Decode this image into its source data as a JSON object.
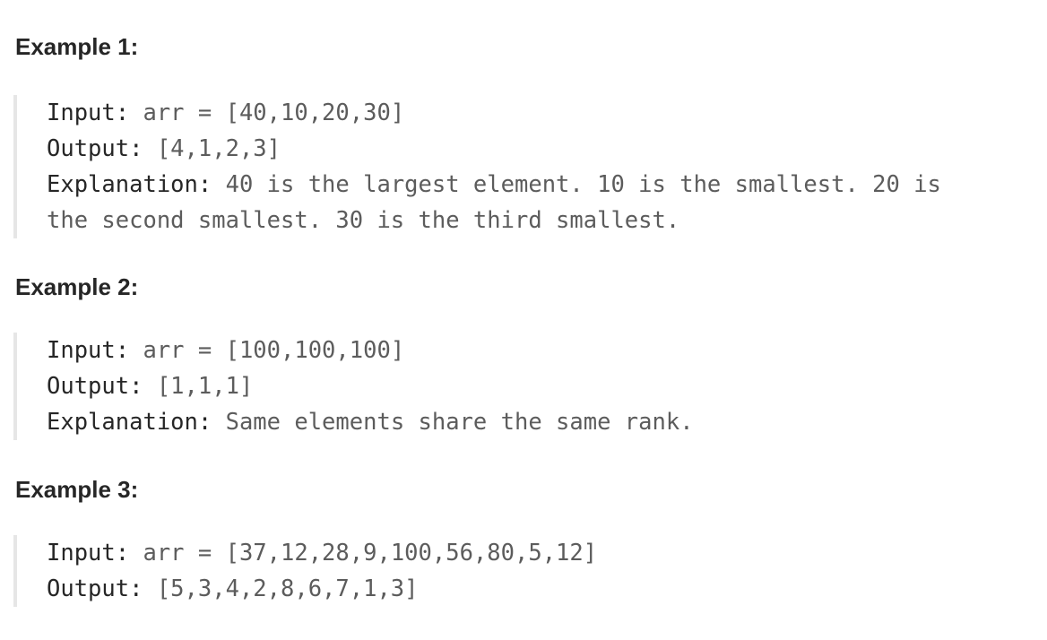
{
  "examples": [
    {
      "heading": "Example 1:",
      "input_label": "Input:",
      "input_value": " arr = [40,10,20,30]",
      "output_label": "Output:",
      "output_value": " [4,1,2,3]",
      "explanation_label": "Explanation:",
      "explanation_line1": " 40 is the largest element. 10 is the smallest. 20 is",
      "explanation_line2": "the second smallest. 30 is the third smallest."
    },
    {
      "heading": "Example 2:",
      "input_label": "Input:",
      "input_value": " arr = [100,100,100]",
      "output_label": "Output:",
      "output_value": " [1,1,1]",
      "explanation_label": "Explanation:",
      "explanation_line1": " Same elements share the same rank."
    },
    {
      "heading": "Example 3:",
      "input_label": "Input:",
      "input_value": " arr = [37,12,28,9,100,56,80,5,12]",
      "output_label": "Output:",
      "output_value": " [5,3,4,2,8,6,7,1,3]"
    }
  ]
}
